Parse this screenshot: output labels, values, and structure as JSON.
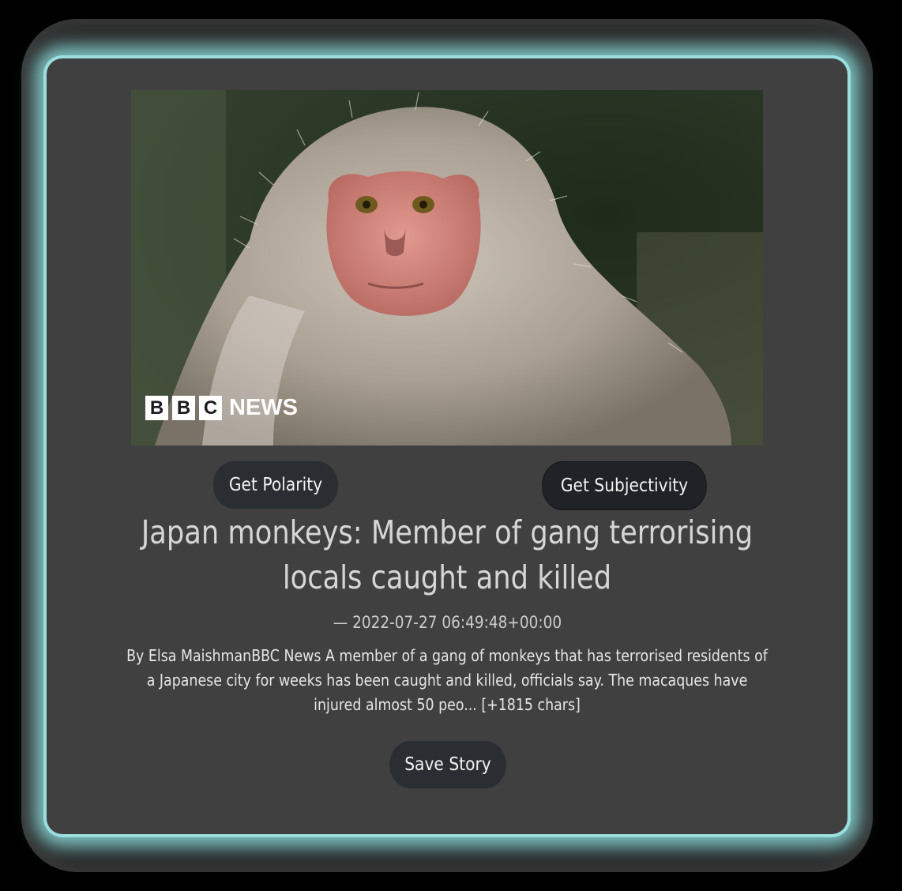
{
  "article": {
    "image": {
      "brand_letters": [
        "B",
        "B",
        "C"
      ],
      "brand_word": "NEWS"
    },
    "buttons": {
      "polarity_label": "Get Polarity",
      "subjectivity_label": "Get Subjectivity",
      "save_label": "Save Story"
    },
    "headline": "Japan monkeys: Member of gang terrorising locals caught and killed",
    "timestamp": "— 2022-07-27 06:49:48+00:00",
    "description": "By Elsa MaishmanBBC News A member of a gang of monkeys that has terrorised residents of a Japanese city for weeks has been caught and killed, officials say. The macaques have injured almost 50 peo... [+1815 chars]"
  },
  "colors": {
    "page_background": "#000000",
    "frame": "#2b2b2b",
    "glow": "#9adede",
    "card": "#404040",
    "button": "#2a2e32",
    "text": "#d6d6d6"
  }
}
